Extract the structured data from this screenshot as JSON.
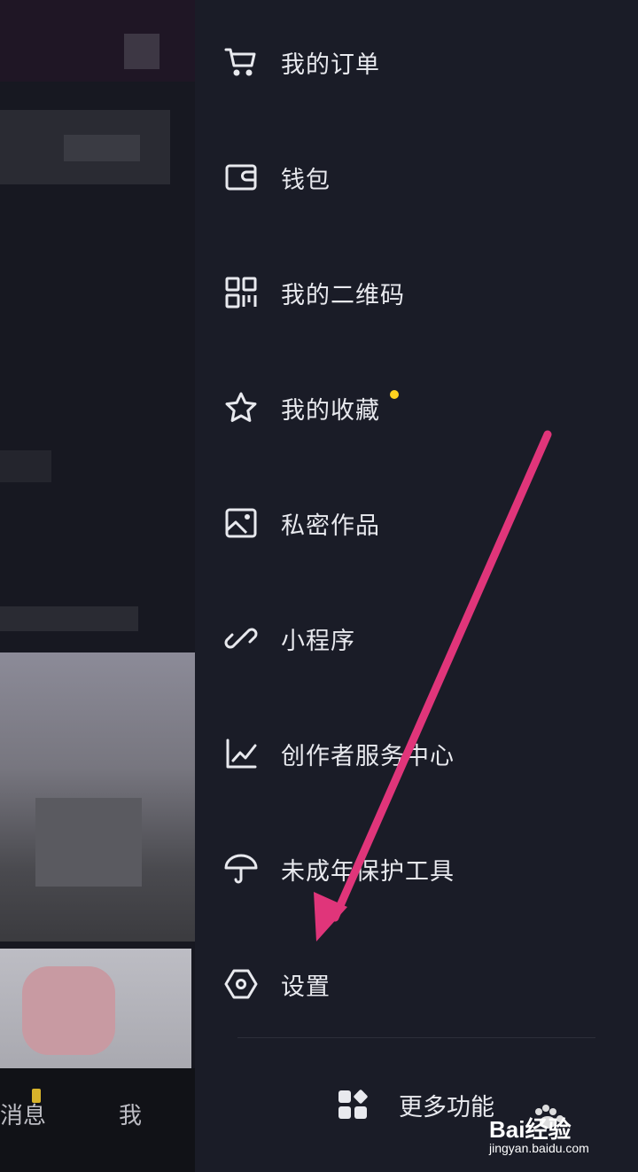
{
  "menu": {
    "items": [
      {
        "label": "我的订单",
        "icon": "cart-icon"
      },
      {
        "label": "钱包",
        "icon": "wallet-icon"
      },
      {
        "label": "我的二维码",
        "icon": "qr-code-icon"
      },
      {
        "label": "我的收藏",
        "icon": "star-icon",
        "has_dot": true
      },
      {
        "label": "私密作品",
        "icon": "image-icon"
      },
      {
        "label": "小程序",
        "icon": "link-icon"
      },
      {
        "label": "创作者服务中心",
        "icon": "chart-icon"
      },
      {
        "label": "未成年保护工具",
        "icon": "umbrella-icon"
      },
      {
        "label": "设置",
        "icon": "hexagon-settings-icon"
      }
    ],
    "more_label": "更多功能"
  },
  "background_app": {
    "nav_labels": [
      "消息",
      "我"
    ]
  },
  "watermark": {
    "brand": "Bai经验",
    "url": "jingyan.baidu.com"
  },
  "colors": {
    "drawer_bg": "#1a1c27",
    "text": "#e8e9ee",
    "notification_dot": "#ffd21f",
    "annotation_arrow": "#e0357a"
  }
}
